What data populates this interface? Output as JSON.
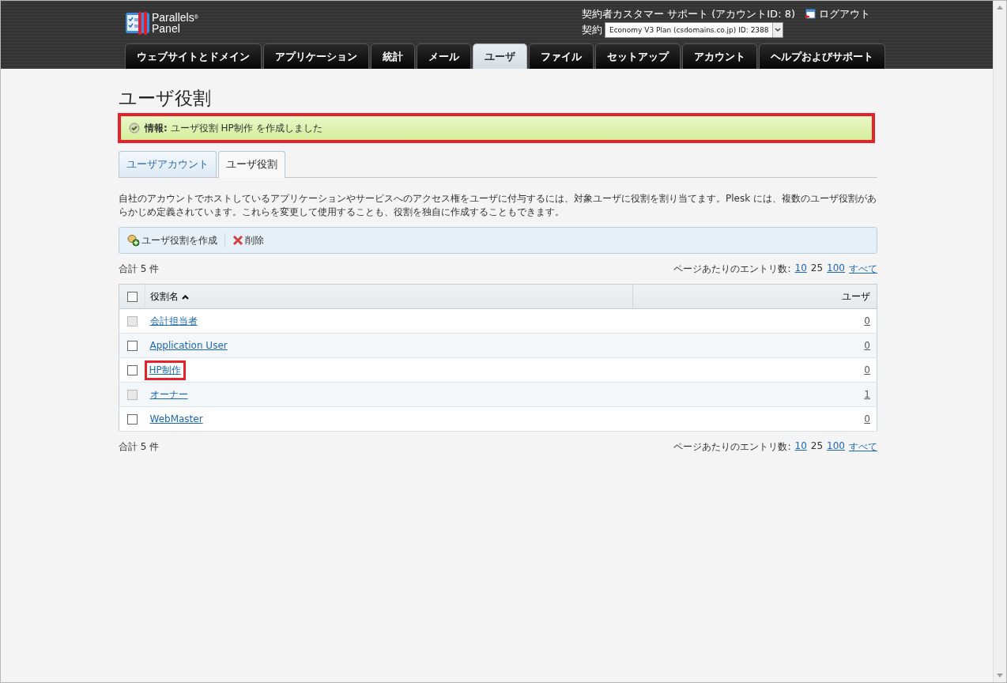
{
  "header": {
    "logo_lines": [
      "Parallels$^{®}$",
      "Panel"
    ],
    "owner": "契約者カスタマー サポート (アカウントID: 8)",
    "logout": "ログアウト",
    "subscription_label": "契約",
    "subscription_value": "Economy V3 Plan (csdomains.co.jp) ID: 2388"
  },
  "nav_tabs": [
    {
      "label": "ウェブサイトとドメイン",
      "selected": false
    },
    {
      "label": "アプリケーション",
      "selected": false
    },
    {
      "label": "統計",
      "selected": false
    },
    {
      "label": "メール",
      "selected": false
    },
    {
      "label": "ユーザ",
      "selected": true
    },
    {
      "label": "ファイル",
      "selected": false
    },
    {
      "label": "セットアップ",
      "selected": false
    },
    {
      "label": "アカウント",
      "selected": false
    },
    {
      "label": "ヘルプおよびサポート",
      "selected": false
    }
  ],
  "page_title": "ユーザ役割",
  "message": {
    "text": "**情報:** ユーザ役割 HP制作 を作成しました",
    "highlighted": true
  },
  "sub_tabs": [
    {
      "label": "ユーザアカウント",
      "selected": false
    },
    {
      "label": "ユーザ役割",
      "selected": true
    }
  ],
  "description": "自社のアカウントでホストしているアプリケーションやサービスへのアクセス権をユーザに付与するには、対象ユーザに役割を割り当てます。Plesk には、複数のユーザ役割があらかじめ定義されています。これらを変更して使用することも、役割を独自に作成することもできます。",
  "toolbar": [
    {
      "label": "ユーザ役割を作成",
      "kind": "create"
    },
    {
      "label": "削除",
      "kind": "delete"
    }
  ],
  "total": "合計 5 件",
  "per_page": {
    "label": "ページあたりのエントリ数:",
    "options": [
      {
        "label": "10",
        "selected": false
      },
      {
        "label": "25",
        "selected": true
      },
      {
        "label": "100",
        "selected": false
      },
      {
        "label": "すべて",
        "selected": false
      }
    ]
  },
  "table": {
    "columns": [
      "役割名",
      "ユーザ"
    ],
    "select_all_checked": false,
    "rows": [
      {
        "name": "会計担当者",
        "users": "0",
        "checked": false,
        "disabled": true,
        "highlighted": false
      },
      {
        "name": "Application User",
        "users": "0",
        "checked": false,
        "disabled": false,
        "highlighted": false
      },
      {
        "name": "HP制作",
        "users": "0",
        "checked": false,
        "disabled": false,
        "highlighted": true
      },
      {
        "name": "オーナー",
        "users": "1",
        "checked": false,
        "disabled": true,
        "highlighted": false
      },
      {
        "name": "WebMaster",
        "users": "0",
        "checked": false,
        "disabled": false,
        "highlighted": false
      }
    ]
  },
  "footer_total": "合計 5 件",
  "footer_per_page": {
    "label": "ページあたりのエントリ数:",
    "options": [
      {
        "label": "10",
        "selected": false
      },
      {
        "label": "25",
        "selected": true
      },
      {
        "label": "100",
        "selected": false
      },
      {
        "label": "すべて",
        "selected": false
      }
    ]
  }
}
